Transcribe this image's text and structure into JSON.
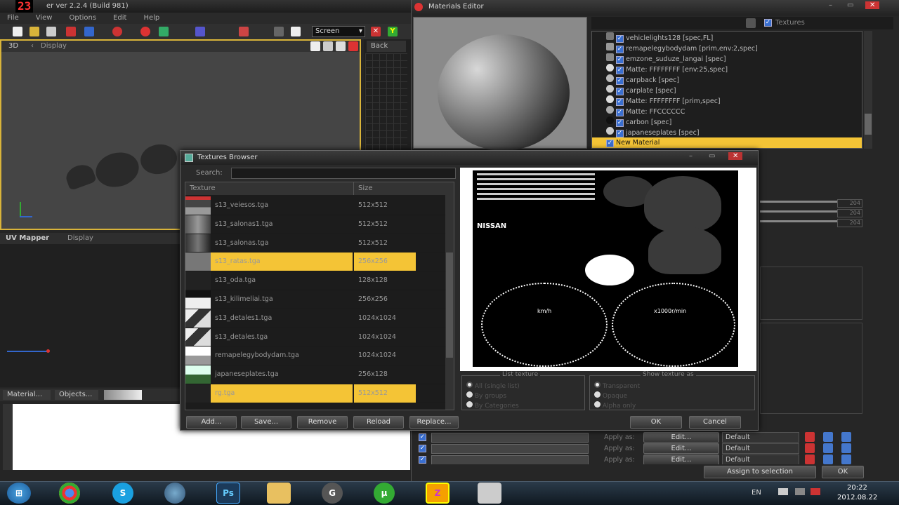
{
  "app": {
    "title": "er ver 2.2.4 (Build 981)",
    "badge": "23",
    "menu": [
      "File",
      "View",
      "Options",
      "Edit",
      "Help"
    ],
    "screen_select": "Screen"
  },
  "viewport3d": {
    "tab": "3D",
    "display_label": "Display",
    "back_label": "Back"
  },
  "uv_mapper": {
    "tab": "UV Mapper",
    "display_label": "Display"
  },
  "bottom_tabs": [
    "Material...",
    "Objects..."
  ],
  "materials_editor": {
    "title": "Materials Editor",
    "textures_label": "Textures",
    "materials": [
      "vehiclelights128 [spec,FL]",
      "remapelegybodydam [prim,env:2,spec]",
      "emzone_suduze_langai [spec]",
      "Matte: FFFFFFFF [env:25,spec]",
      "carpback [spec]",
      "carplate [spec]",
      "Matte: FFFFFFFF [prim,spec]",
      "Matte: FFCCCCCC",
      "carbon [spec]",
      "japaneseplates [spec]",
      "New Material"
    ],
    "apply_rows": [
      {
        "apply": "Apply as:",
        "edit": "Edit...",
        "mode": "Default"
      },
      {
        "apply": "Apply as:",
        "edit": "Edit...",
        "mode": "Default"
      },
      {
        "apply": "Apply as:",
        "edit": "Edit...",
        "mode": "Default"
      }
    ],
    "slider_values": [
      "204",
      "204",
      "204"
    ],
    "assign_button": "Assign to selection",
    "ok_button": "OK"
  },
  "textures_browser": {
    "title": "Textures Browser",
    "search_label": "Search:",
    "col_texture": "Texture",
    "col_size": "Size",
    "rows": [
      {
        "name": "s13_veiesos.tga",
        "size": "512x512"
      },
      {
        "name": "s13_salonas1.tga",
        "size": "512x512"
      },
      {
        "name": "s13_salonas.tga",
        "size": "512x512"
      },
      {
        "name": "s13_ratas.tga",
        "size": "256x256"
      },
      {
        "name": "s13_oda.tga",
        "size": "128x128"
      },
      {
        "name": "s13_kilimeliai.tga",
        "size": "256x256"
      },
      {
        "name": "s13_detales1.tga",
        "size": "1024x1024"
      },
      {
        "name": "s13_detales.tga",
        "size": "1024x1024"
      },
      {
        "name": "remapelegybodydam.tga",
        "size": "1024x1024"
      },
      {
        "name": "japaneseplates.tga",
        "size": "256x128"
      },
      {
        "name": "rg.tga",
        "size": "512x512"
      }
    ],
    "buttons": [
      "Add...",
      "Save...",
      "Remove",
      "Reload",
      "Replace..."
    ],
    "list_texture_label": "List texture",
    "list_options": [
      "All (single list)",
      "By groups",
      "By Categories"
    ],
    "show_texture_label": "Show texture as",
    "show_options": [
      "Transparent",
      "Opaque",
      "Alpha only"
    ],
    "ok": "OK",
    "cancel": "Cancel",
    "preview_text": [
      "NISSAN",
      "km/h",
      "x1000r/min"
    ]
  },
  "taskbar": {
    "language": "EN",
    "time": "20:22",
    "date": "2012.08.22",
    "apps": [
      "windows-start",
      "chrome",
      "skype",
      "network",
      "photoshop",
      "explorer",
      "g-app",
      "utorrent",
      "zmodeler",
      "app"
    ]
  }
}
